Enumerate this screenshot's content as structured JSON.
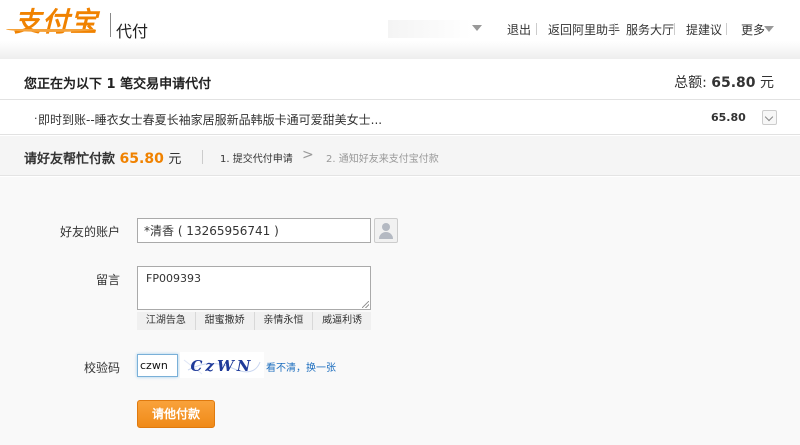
{
  "header": {
    "logo_text": "支付宝",
    "product": "代付",
    "user_caret_icon": "chevron-down-icon",
    "nav": [
      "退出",
      "返回阿里助手",
      "服务大厅",
      "提建议",
      "更多"
    ]
  },
  "summary": {
    "title": "您正在为以下 1 笔交易申请代付",
    "total_label": "总额:",
    "total_amount": "65.80",
    "total_unit": "元"
  },
  "item": {
    "bullet": "·",
    "name": "即时到账--睡衣女士春夏长袖家居服新品韩版卡通可爱甜美女士...",
    "price": "65.80"
  },
  "steps": {
    "ask_label": "请好友帮忙付款",
    "ask_amount": "65.80",
    "ask_unit": "元",
    "step1": "1. 提交代付申请",
    "arrow": ">",
    "step2": "2. 通知好友来支付宝付款"
  },
  "form": {
    "friend_label": "好友的账户",
    "friend_value": "*清香 ( 13265956741 )",
    "memo_label": "留言",
    "memo_value": "FP009393",
    "quick_messages": [
      "江湖告急",
      "甜蜜撒娇",
      "亲情永恒",
      "威逼利诱"
    ],
    "captcha_label": "校验码",
    "captcha_value": "czwn",
    "captcha_text": "CzWN",
    "captcha_refresh": "看不清，换一张",
    "submit": "请他付款"
  },
  "colors": {
    "brand": "#f08200",
    "link": "#1e6fbf",
    "button": "#f39a2c"
  }
}
